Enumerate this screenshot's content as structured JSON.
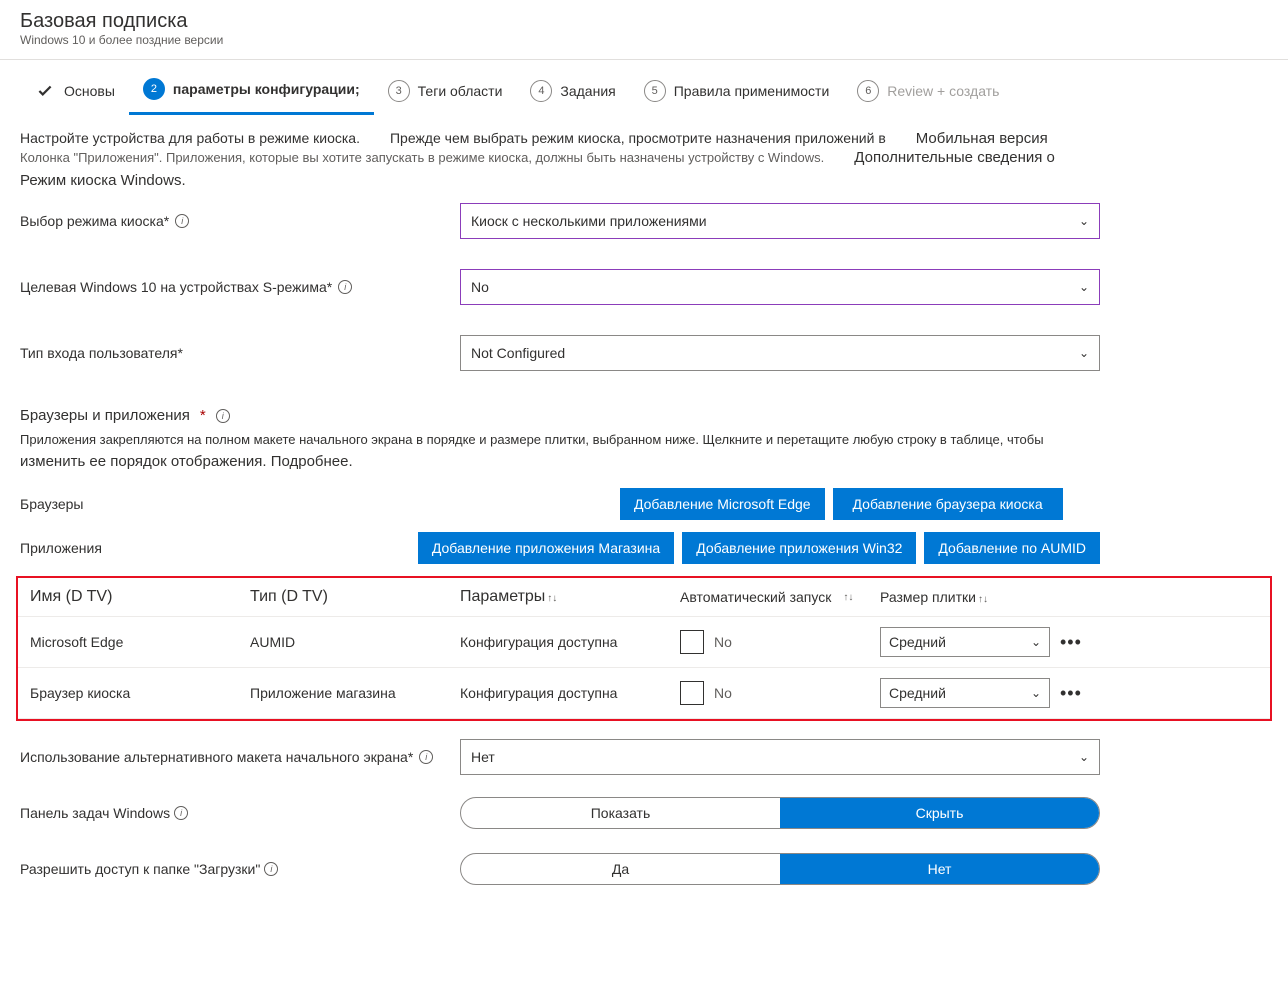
{
  "header": {
    "title": "Базовая подписка",
    "subtitle": "Windows 10 и более поздние версии"
  },
  "steps": {
    "s1": "Основы",
    "s2_num": "2",
    "s2": "параметры конфигурации;",
    "s3_num": "3",
    "s3": "Теги области",
    "s4_num": "4",
    "s4": "Задания",
    "s5_num": "5",
    "s5": "Правила применимости",
    "s6_num": "6",
    "s6": "Review + создать"
  },
  "intro": {
    "a": "Настройте устройства для работы в режиме киоска.",
    "b": "Прежде чем выбрать режим киоска, просмотрите назначения приложений в",
    "c": "Мобильная версия",
    "d": "Колонка \"Приложения\". Приложения, которые вы хотите запускать в режиме киоска, должны быть назначены устройству с Windows.",
    "e": "Дополнительные сведения о",
    "f": "Режим киоска Windows."
  },
  "fields": {
    "kiosk_mode_label": "Выбор режима киоска*",
    "kiosk_mode_value": "Киоск с несколькими приложениями",
    "target_label": "Целевая Windows 10 на устройствах S-режима*",
    "target_value": "No",
    "logon_label": "Тип входа пользователя*",
    "logon_value": "Not Configured"
  },
  "apps_section": {
    "head": "Браузеры и приложения",
    "desc": "Приложения закрепляются на полном макете начального экрана в порядке и размере плитки, выбранном ниже. Щелкните и перетащите любую строку в таблице, чтобы",
    "desc2": "изменить ее порядок отображения. Подробнее.",
    "browsers_label": "Браузеры",
    "apps_label": "Приложения",
    "btn_edge": "Добавление Microsoft Edge",
    "btn_kiosk_browser": "Добавление браузера киоска",
    "btn_store": "Добавление приложения Магазина",
    "btn_win32": "Добавление приложения Win32",
    "btn_aumid": "Добавление по AUMID"
  },
  "table": {
    "h_name": "Имя (D TV)",
    "h_type": "Тип (D TV)",
    "h_params": "Параметры",
    "h_auto": "Автоматический запуск",
    "h_size": "Размер плитки",
    "rows": [
      {
        "name": "Microsoft Edge",
        "type": "AUMID",
        "params": "Конфигурация доступна",
        "auto": "No",
        "size": "Средний"
      },
      {
        "name": "Браузер киоска",
        "type": "Приложение магазина",
        "params": "Конфигурация доступна",
        "auto": "No",
        "size": "Средний"
      }
    ],
    "more": "•••"
  },
  "bottom": {
    "alt_layout_label": "Использование альтернативного макета начального экрана*",
    "alt_layout_value": "Нет",
    "taskbar_label": "Панель задач Windows",
    "taskbar_show": "Показать",
    "taskbar_hide": "Скрыть",
    "downloads_label": "Разрешить доступ к папке \"Загрузки\"",
    "downloads_yes": "Да",
    "downloads_no": "Нет"
  }
}
